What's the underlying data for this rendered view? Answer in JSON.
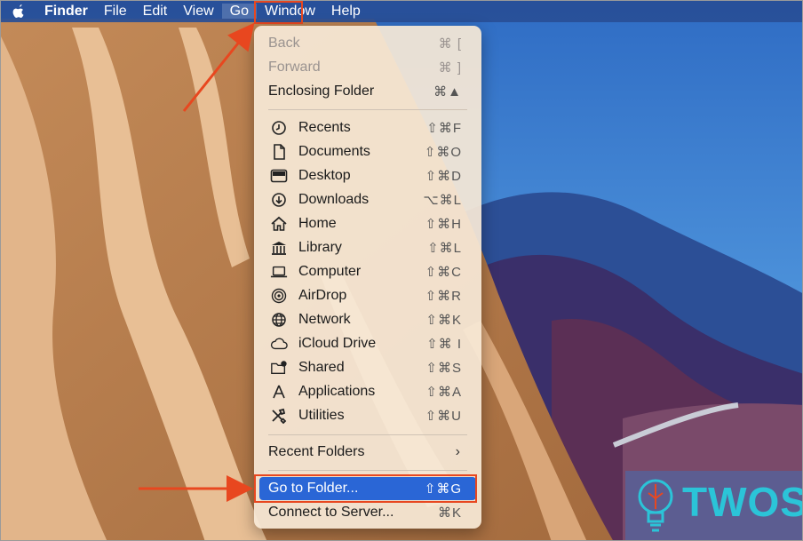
{
  "menubar": {
    "apple_icon": "apple-logo",
    "items": [
      "Finder",
      "File",
      "Edit",
      "View",
      "Go",
      "Window",
      "Help"
    ]
  },
  "menu": {
    "back": {
      "label": "Back",
      "shortcut": "⌘ ["
    },
    "forward": {
      "label": "Forward",
      "shortcut": "⌘ ]"
    },
    "enclosing": {
      "label": "Enclosing Folder",
      "shortcut": "⌘▲"
    },
    "places": [
      {
        "label": "Recents",
        "shortcut": "⇧⌘F",
        "icon": "clock-icon"
      },
      {
        "label": "Documents",
        "shortcut": "⇧⌘O",
        "icon": "document-icon"
      },
      {
        "label": "Desktop",
        "shortcut": "⇧⌘D",
        "icon": "desktop-icon"
      },
      {
        "label": "Downloads",
        "shortcut": "⌥⌘L",
        "icon": "download-icon"
      },
      {
        "label": "Home",
        "shortcut": "⇧⌘H",
        "icon": "house-icon"
      },
      {
        "label": "Library",
        "shortcut": "⇧⌘L",
        "icon": "library-icon"
      },
      {
        "label": "Computer",
        "shortcut": "⇧⌘C",
        "icon": "laptop-icon"
      },
      {
        "label": "AirDrop",
        "shortcut": "⇧⌘R",
        "icon": "airdrop-icon"
      },
      {
        "label": "Network",
        "shortcut": "⇧⌘K",
        "icon": "globe-icon"
      },
      {
        "label": "iCloud Drive",
        "shortcut": "⇧⌘ I",
        "icon": "cloud-icon"
      },
      {
        "label": "Shared",
        "shortcut": "⇧⌘S",
        "icon": "shared-folder-icon"
      },
      {
        "label": "Applications",
        "shortcut": "⇧⌘A",
        "icon": "applications-icon"
      },
      {
        "label": "Utilities",
        "shortcut": "⇧⌘U",
        "icon": "utilities-icon"
      }
    ],
    "recent_folders": {
      "label": "Recent Folders",
      "chevron": "›"
    },
    "go_to_folder": {
      "label": "Go to Folder...",
      "shortcut": "⇧⌘G"
    },
    "connect_server": {
      "label": "Connect to Server...",
      "shortcut": "⌘K"
    }
  },
  "watermark": {
    "text": "TWOS"
  },
  "colors": {
    "accent": "#e8471f",
    "selection": "#2a66d6",
    "logo": "#2bc4d8"
  }
}
